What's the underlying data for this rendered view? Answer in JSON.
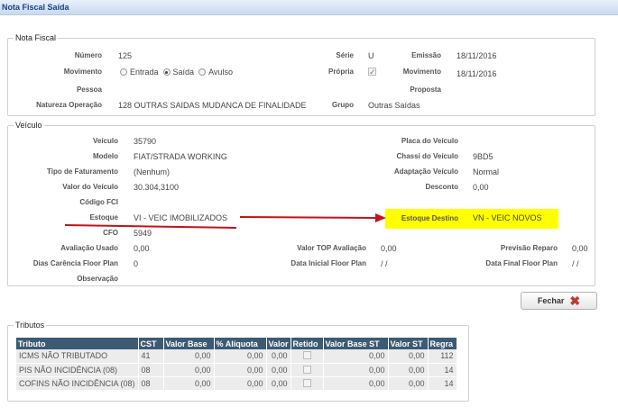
{
  "window_title": "Nota Fiscal Saída",
  "nota_fiscal": {
    "legend": "Nota Fiscal",
    "numero_label": "Número",
    "numero": "125",
    "serie_label": "Série",
    "serie": "U",
    "emissao_label": "Emissão",
    "emissao": "18/11/2016",
    "movimento_label": "Movimento",
    "opt_entrada": "Entrada",
    "opt_saida": "Saída",
    "opt_avulso": "Avulso",
    "selected_option": "Saída",
    "propria_label": "Própria",
    "propria_checked": true,
    "movimento2_label": "Movimento",
    "movimento2": "18/11/2016",
    "pessoa_label": "Pessoa",
    "pessoa": "",
    "proposta_label": "Proposta",
    "proposta": "",
    "natureza_label": "Natureza Operação",
    "natureza": "128  OUTRAS SAIDAS MUDANCA DE FINALIDADE",
    "grupo_label": "Grupo",
    "grupo": "Outras Saídas"
  },
  "veiculo": {
    "legend": "Veículo",
    "veiculo_label": "Veículo",
    "veiculo": "35790",
    "placa_label": "Placa do Veículo",
    "placa": "",
    "modelo_label": "Modelo",
    "modelo": "FIAT/STRADA WORKING",
    "chassi_label": "Chassi do Veículo",
    "chassi": "9BD5",
    "tipo_fat_label": "Tipo de Faturamento",
    "tipo_fat": "(Nenhum)",
    "adaptacao_label": "Adaptação Veículo",
    "adaptacao": "Normal",
    "valor_label": "Valor do Veículo",
    "valor": "30.304,3100",
    "desconto_label": "Desconto",
    "desconto": "0,00",
    "fci_label": "Código FCI",
    "fci": "",
    "estoque_label": "Estoque",
    "estoque": "VI - VEIC IMOBILIZADOS",
    "estoque_destino_label": "Estoque Destino",
    "estoque_destino": "VN - VEIC NOVOS",
    "cfo_label": "CFO",
    "cfo": "5949",
    "aval_usado_label": "Avaliação Usado",
    "aval_usado": "0,00",
    "valor_top_label": "Valor TOP Avaliação",
    "valor_top": "0,00",
    "previsao_label": "Previsão Reparo",
    "previsao": "0,00",
    "dias_label": "Dias Carência Floor Plan",
    "dias": "0",
    "data_ini_label": "Data Inicial Floor Plan",
    "data_ini": "/ /",
    "data_fim_label": "Data Final Floor Plan",
    "data_fim": "/ /",
    "obs_label": "Observação",
    "obs": "",
    "highlight_color": "#ffff00",
    "arrow_color": "#c0141c"
  },
  "fechar_label": "Fechar",
  "tributos": {
    "legend": "Tributos",
    "headers": [
      "Tributo",
      "CST",
      "Valor Base",
      "% Alíquota",
      "Valor",
      "Retido",
      "Valor Base ST",
      "Valor ST",
      "Regra"
    ],
    "rows": [
      {
        "tributo": "ICMS NÃO TRIBUTADO",
        "cst": "41",
        "base": "0,00",
        "aliq": "0,00",
        "valor": "0,00",
        "retido": false,
        "base_st": "0,00",
        "valor_st": "0,00",
        "regra": "112"
      },
      {
        "tributo": "PIS NÃO INCIDÊNCIA (08)",
        "cst": "08",
        "base": "0,00",
        "aliq": "0,00",
        "valor": "0,00",
        "retido": false,
        "base_st": "0,00",
        "valor_st": "0,00",
        "regra": "14"
      },
      {
        "tributo": "COFINS NÃO INCIDÊNCIA (08)",
        "cst": "08",
        "base": "0,00",
        "aliq": "0,00",
        "valor": "0,00",
        "retido": false,
        "base_st": "0,00",
        "valor_st": "0,00",
        "regra": "14"
      }
    ]
  }
}
